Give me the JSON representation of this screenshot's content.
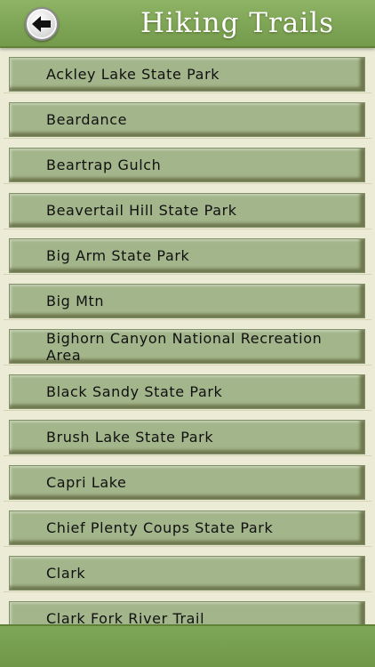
{
  "header": {
    "title": "Hiking Trails",
    "back_icon": "back-arrow-icon"
  },
  "trails": [
    "Ackley Lake State Park",
    "Beardance",
    "Beartrap Gulch",
    "Beavertail Hill State Park",
    "Big Arm State Park",
    "Big Mtn",
    "Bighorn Canyon National Recreation Area",
    "Black Sandy State Park",
    "Brush Lake State Park",
    "Capri Lake",
    "Chief Plenty Coups State Park",
    "Clark",
    "Clark Fork River Trail"
  ],
  "colors": {
    "header": "#7ea455",
    "tile": "#a3b58a",
    "background": "#ecebd6"
  }
}
